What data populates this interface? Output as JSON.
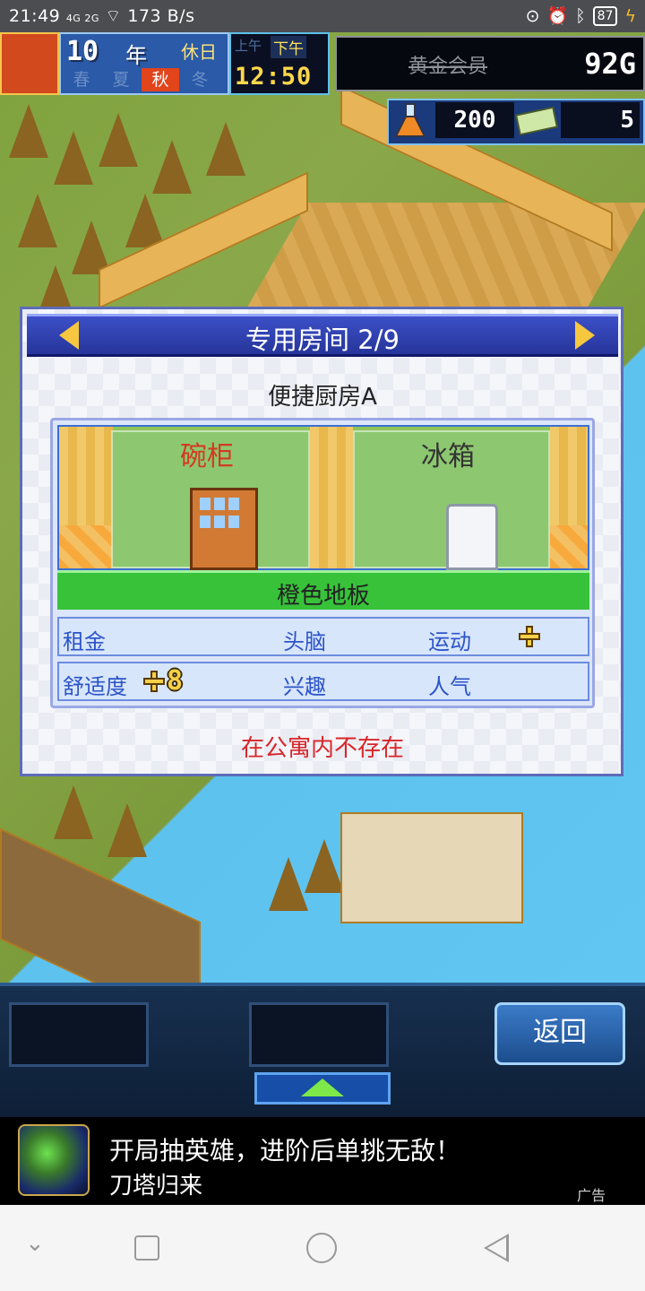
{
  "status_bar": {
    "time": "21:49",
    "signal": "4G 2G",
    "speed": "173 B/s",
    "battery": "87"
  },
  "hud": {
    "year": "10",
    "year_unit": "年",
    "day_label": "休日",
    "seasons": [
      "春",
      "夏",
      "秋",
      "冬"
    ],
    "current_season": "秋",
    "am_label": "上午",
    "pm_label": "下午",
    "clock": "12:50",
    "member_label": "黄金会员",
    "gold": "92G",
    "research_points": "200",
    "tickets": "5"
  },
  "modal": {
    "title": "专用房间 2/9",
    "room_name": "便捷厨房A",
    "items": [
      "碗柜",
      "冰箱"
    ],
    "floor": "橙色地板",
    "stats": {
      "rent": "租金",
      "brain": "头脑",
      "exercise": "运动",
      "comfort": "舒适度",
      "comfort_value": "8",
      "interest": "兴趣",
      "popularity": "人气"
    },
    "notice": "在公寓内不存在"
  },
  "bottom_bar": {
    "back_label": "返回"
  },
  "ad": {
    "title": "开局抽英雄，进阶后单挑无敌！",
    "subtitle": "刀塔归来",
    "tag": "广告"
  },
  "colors": {
    "modal_header": "#3c4fc7",
    "highlight_red": "#d23a22",
    "stat_blue": "#2c54c8",
    "floor_green": "#37c23a"
  }
}
